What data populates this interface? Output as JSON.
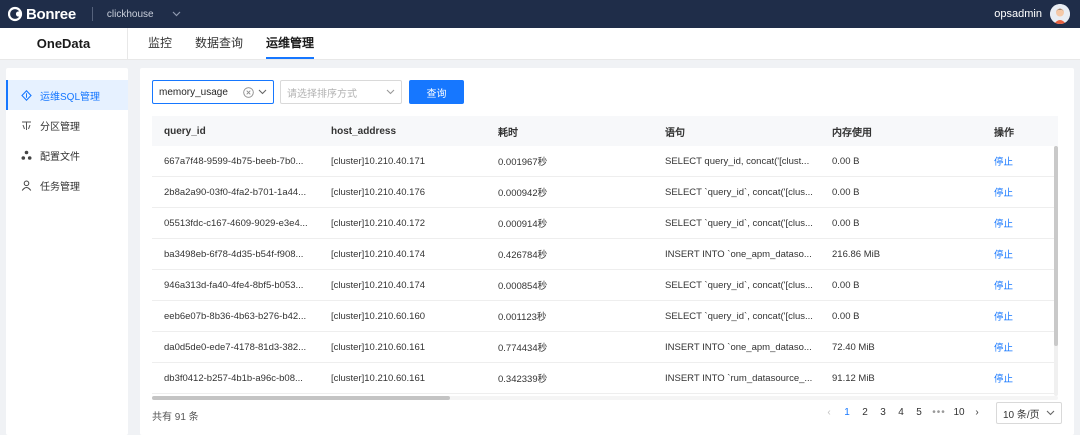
{
  "topbar": {
    "brand": "Bonree",
    "project": "clickhouse",
    "user": "opsadmin"
  },
  "subhead": {
    "product": "OneData",
    "tabs": [
      {
        "label": "监控"
      },
      {
        "label": "数据查询"
      },
      {
        "label": "运维管理",
        "active": true
      }
    ]
  },
  "sidebar": {
    "items": [
      {
        "label": "运维SQL管理",
        "icon": "diamond-icon",
        "active": true
      },
      {
        "label": "分区管理",
        "icon": "partition-icon"
      },
      {
        "label": "配置文件",
        "icon": "config-icon"
      },
      {
        "label": "任务管理",
        "icon": "user-icon"
      }
    ]
  },
  "filters": {
    "type_value": "memory_usage",
    "sort_placeholder": "请选择排序方式",
    "query_label": "查询"
  },
  "table": {
    "headers": [
      "query_id",
      "host_address",
      "耗时",
      "语句",
      "内存使用",
      "操作"
    ],
    "rows": [
      [
        "667a7f48-9599-4b75-beeb-7b0...",
        "[cluster]10.210.40.171",
        "0.001967秒",
        "SELECT query_id, concat('[clust...",
        "0.00 B",
        "停止"
      ],
      [
        "2b8a2a90-03f0-4fa2-b701-1a44...",
        "[cluster]10.210.40.176",
        "0.000942秒",
        "SELECT `query_id`, concat('[clus...",
        "0.00 B",
        "停止"
      ],
      [
        "05513fdc-c167-4609-9029-e3e4...",
        "[cluster]10.210.40.172",
        "0.000914秒",
        "SELECT `query_id`, concat('[clus...",
        "0.00 B",
        "停止"
      ],
      [
        "ba3498eb-6f78-4d35-b54f-f908...",
        "[cluster]10.210.40.174",
        "0.426784秒",
        "INSERT INTO `one_apm_dataso...",
        "216.86 MiB",
        "停止"
      ],
      [
        "946a313d-fa40-4fe4-8bf5-b053...",
        "[cluster]10.210.40.174",
        "0.000854秒",
        "SELECT `query_id`, concat('[clus...",
        "0.00 B",
        "停止"
      ],
      [
        "eeb6e07b-8b36-4b63-b276-b42...",
        "[cluster]10.210.60.160",
        "0.001123秒",
        "SELECT `query_id`, concat('[clus...",
        "0.00 B",
        "停止"
      ],
      [
        "da0d5de0-ede7-4178-81d3-382...",
        "[cluster]10.210.60.161",
        "0.774434秒",
        "INSERT INTO `one_apm_dataso...",
        "72.40 MiB",
        "停止"
      ],
      [
        "db3f0412-b257-4b1b-a96c-b08...",
        "[cluster]10.210.60.161",
        "0.342339秒",
        "INSERT INTO `rum_datasource_...",
        "91.12 MiB",
        "停止"
      ]
    ]
  },
  "pagination": {
    "total": "共有 91 条",
    "prev": "‹",
    "pages": [
      "1",
      "2",
      "3",
      "4",
      "5"
    ],
    "ellipsis": "•••",
    "last": "10",
    "next": "›",
    "page_size": "10 条/页"
  },
  "colors": {
    "accent": "#1677ff",
    "topbar": "#1f2d49"
  }
}
